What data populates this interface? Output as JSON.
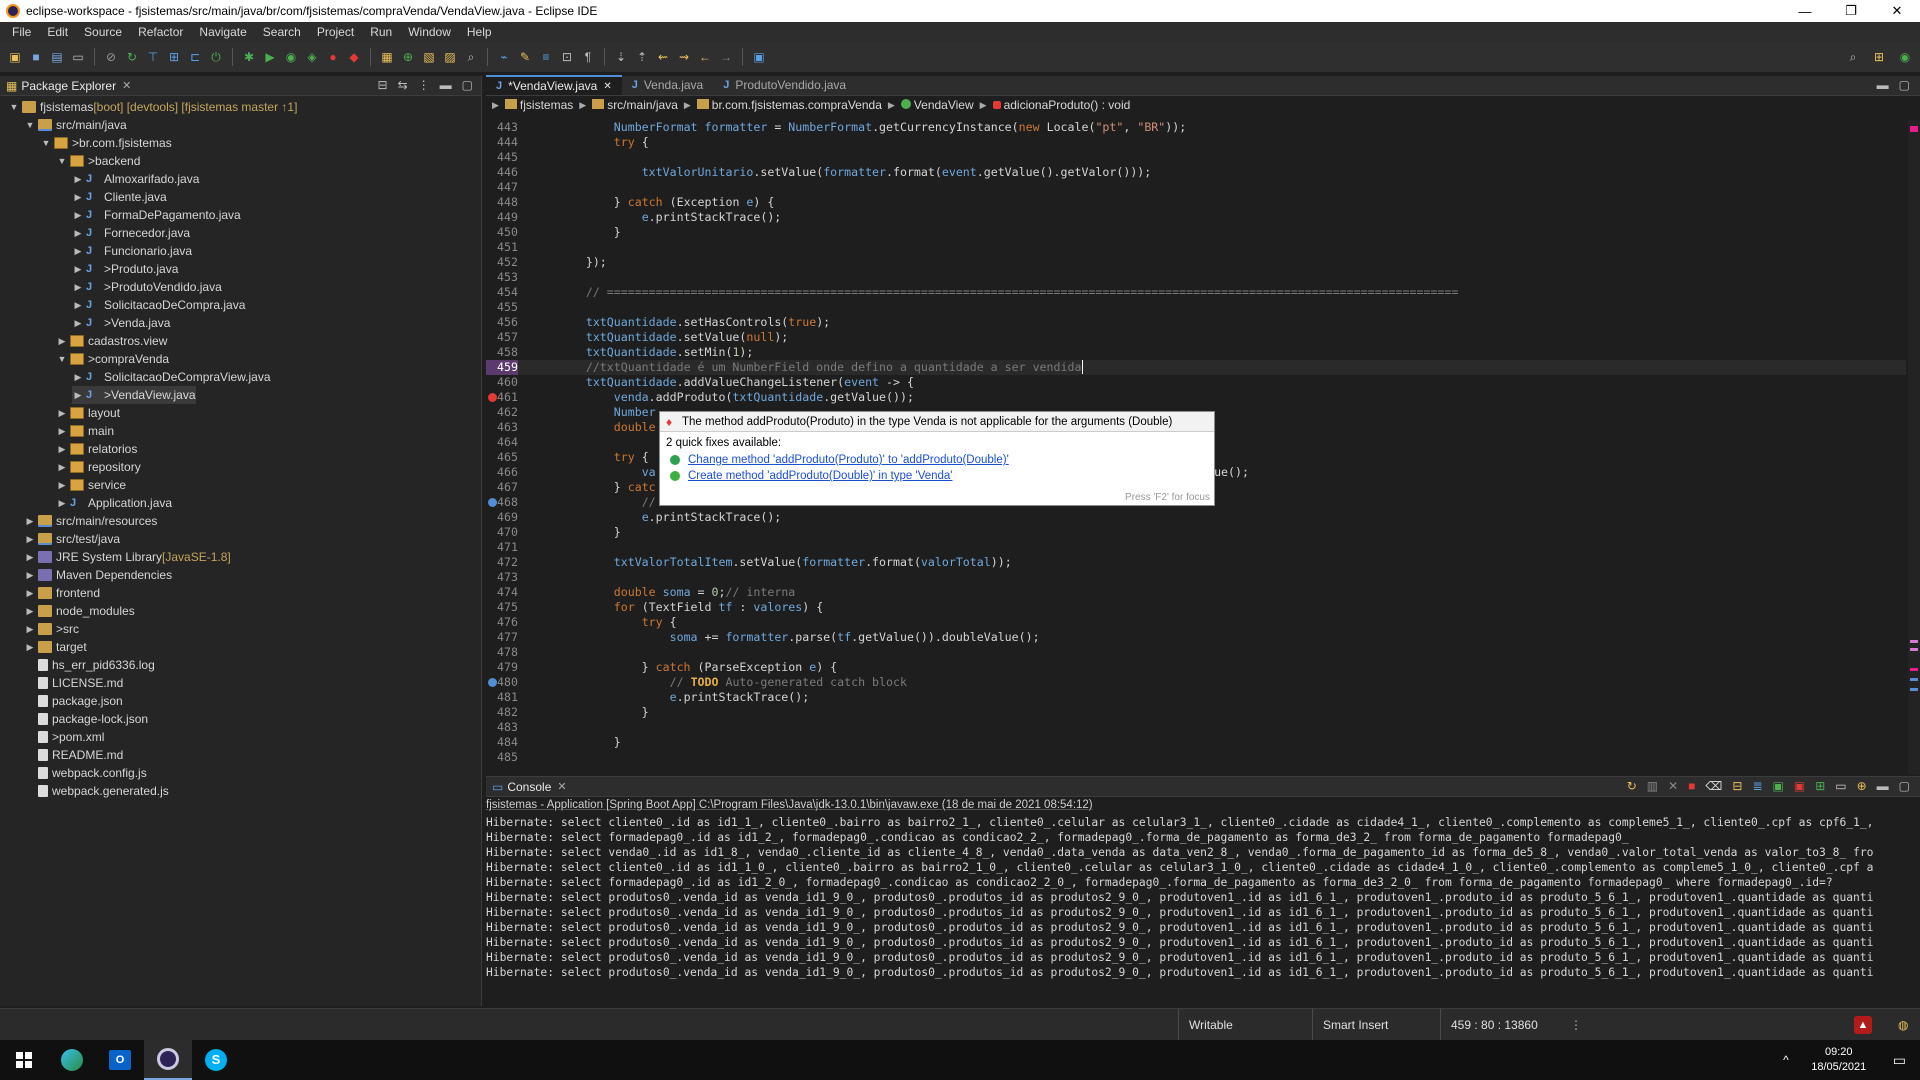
{
  "window": {
    "title": "eclipse-workspace - fjsistemas/src/main/java/br/com/fjsistemas/compraVenda/VendaView.java - Eclipse IDE"
  },
  "menu": [
    "File",
    "Edit",
    "Source",
    "Refactor",
    "Navigate",
    "Search",
    "Project",
    "Run",
    "Window",
    "Help"
  ],
  "package_explorer": {
    "title": "Package Explorer",
    "tree": [
      {
        "label": "fjsistemas",
        "decor": " [boot] [devtools] [fjsistemas master ↑1]",
        "indent": 0,
        "expanded": true,
        "icon": "project"
      },
      {
        "label": "src/main/java",
        "decor": "",
        "indent": 1,
        "expanded": true,
        "icon": "src"
      },
      {
        "label": "br.com.fjsistemas",
        "decor": "",
        "prefix": "> ",
        "indent": 2,
        "expanded": true,
        "icon": "pkg"
      },
      {
        "label": "backend",
        "decor": "",
        "prefix": "> ",
        "indent": 3,
        "expanded": true,
        "icon": "pkg"
      },
      {
        "label": "Almoxarifado.java",
        "decor": "",
        "indent": 4,
        "expanded": false,
        "icon": "java"
      },
      {
        "label": "Cliente.java",
        "decor": "",
        "indent": 4,
        "expanded": false,
        "icon": "java"
      },
      {
        "label": "FormaDePagamento.java",
        "decor": "",
        "indent": 4,
        "expanded": false,
        "icon": "java"
      },
      {
        "label": "Fornecedor.java",
        "decor": "",
        "indent": 4,
        "expanded": false,
        "icon": "java"
      },
      {
        "label": "Funcionario.java",
        "decor": "",
        "indent": 4,
        "expanded": false,
        "icon": "java"
      },
      {
        "label": "Produto.java",
        "decor": "",
        "prefix": "> ",
        "indent": 4,
        "expanded": false,
        "icon": "java"
      },
      {
        "label": "ProdutoVendido.java",
        "decor": "",
        "prefix": "> ",
        "indent": 4,
        "expanded": false,
        "icon": "java"
      },
      {
        "label": "SolicitacaoDeCompra.java",
        "decor": "",
        "indent": 4,
        "expanded": false,
        "icon": "java"
      },
      {
        "label": "Venda.java",
        "decor": "",
        "prefix": "> ",
        "indent": 4,
        "expanded": false,
        "icon": "java"
      },
      {
        "label": "cadastros.view",
        "decor": "",
        "indent": 3,
        "expanded": false,
        "icon": "pkg"
      },
      {
        "label": "compraVenda",
        "decor": "",
        "prefix": "> ",
        "indent": 3,
        "expanded": true,
        "icon": "pkg"
      },
      {
        "label": "SolicitacaoDeCompraView.java",
        "decor": "",
        "indent": 4,
        "expanded": false,
        "icon": "java"
      },
      {
        "label": "VendaView.java",
        "decor": "",
        "prefix": "> ",
        "indent": 4,
        "expanded": false,
        "icon": "java",
        "selected": true
      },
      {
        "label": "layout",
        "decor": "",
        "indent": 3,
        "expanded": false,
        "icon": "pkg"
      },
      {
        "label": "main",
        "decor": "",
        "indent": 3,
        "expanded": false,
        "icon": "pkg"
      },
      {
        "label": "relatorios",
        "decor": "",
        "indent": 3,
        "expanded": false,
        "icon": "pkg"
      },
      {
        "label": "repository",
        "decor": "",
        "indent": 3,
        "expanded": false,
        "icon": "pkg"
      },
      {
        "label": "service",
        "decor": "",
        "indent": 3,
        "expanded": false,
        "icon": "pkg"
      },
      {
        "label": "Application.java",
        "decor": "",
        "indent": 3,
        "expanded": false,
        "icon": "java"
      },
      {
        "label": "src/main/resources",
        "decor": "",
        "indent": 1,
        "expanded": false,
        "icon": "src"
      },
      {
        "label": "src/test/java",
        "decor": "",
        "indent": 1,
        "expanded": false,
        "icon": "src"
      },
      {
        "label": "JRE System Library",
        "decor": " [JavaSE-1.8]",
        "indent": 1,
        "expanded": false,
        "icon": "lib"
      },
      {
        "label": "Maven Dependencies",
        "decor": "",
        "indent": 1,
        "expanded": false,
        "icon": "lib"
      },
      {
        "label": "frontend",
        "decor": "",
        "indent": 1,
        "expanded": false,
        "icon": "folder"
      },
      {
        "label": "node_modules",
        "decor": "",
        "indent": 1,
        "expanded": false,
        "icon": "folder"
      },
      {
        "label": "src",
        "decor": "",
        "prefix": "> ",
        "indent": 1,
        "expanded": false,
        "icon": "folder"
      },
      {
        "label": "target",
        "decor": "",
        "indent": 1,
        "expanded": false,
        "icon": "folder"
      },
      {
        "label": "hs_err_pid6336.log",
        "decor": "",
        "indent": 1,
        "leaf": true,
        "icon": "file"
      },
      {
        "label": "LICENSE.md",
        "decor": "",
        "indent": 1,
        "leaf": true,
        "icon": "file"
      },
      {
        "label": "package.json",
        "decor": "",
        "indent": 1,
        "leaf": true,
        "icon": "file"
      },
      {
        "label": "package-lock.json",
        "decor": "",
        "indent": 1,
        "leaf": true,
        "icon": "file"
      },
      {
        "label": "pom.xml",
        "decor": "",
        "prefix": "> ",
        "indent": 1,
        "leaf": true,
        "icon": "file"
      },
      {
        "label": "README.md",
        "decor": "",
        "indent": 1,
        "leaf": true,
        "icon": "file"
      },
      {
        "label": "webpack.config.js",
        "decor": "",
        "indent": 1,
        "leaf": true,
        "icon": "file"
      },
      {
        "label": "webpack.generated.js",
        "decor": "",
        "indent": 1,
        "leaf": true,
        "icon": "file"
      }
    ]
  },
  "editor": {
    "tabs": [
      {
        "label": "*VendaView.java",
        "active": true
      },
      {
        "label": "Venda.java",
        "active": false
      },
      {
        "label": "ProdutoVendido.java",
        "active": false
      }
    ],
    "breadcrumb": [
      "fjsistemas",
      "src/main/java",
      "br.com.fjsistemas.compraVenda",
      "VendaView",
      "adicionaProduto() : void"
    ],
    "current_line": "459",
    "lines": [
      {
        "n": "443",
        "html": "            <span class=\"f\">NumberFormat</span> <span class=\"f\">formatter</span> = <span class=\"f\">NumberFormat</span>.getCurrencyInstance(<span class=\"k\">new</span> Locale(<span class=\"s\">\"pt\"</span>, <span class=\"s\">\"BR\"</span>));"
      },
      {
        "n": "444",
        "html": "            <span class=\"k\">try</span> {"
      },
      {
        "n": "445",
        "html": ""
      },
      {
        "n": "446",
        "html": "                <span class=\"f\">txtValorUnitario</span>.setValue(<span class=\"f\">formatter</span>.format(<span class=\"f\">event</span>.getValue().getValor()));"
      },
      {
        "n": "447",
        "html": ""
      },
      {
        "n": "448",
        "html": "            } <span class=\"k\">catch</span> (Exception <span class=\"f\">e</span>) {"
      },
      {
        "n": "449",
        "html": "                <span class=\"f\">e</span>.printStackTrace();"
      },
      {
        "n": "450",
        "html": "            }"
      },
      {
        "n": "451",
        "html": ""
      },
      {
        "n": "452",
        "html": "        });"
      },
      {
        "n": "453",
        "html": ""
      },
      {
        "n": "454",
        "html": "        <span class=\"c\">// ==========================================================================================================================</span>"
      },
      {
        "n": "455",
        "html": ""
      },
      {
        "n": "456",
        "html": "        <span class=\"f\">txtQuantidade</span>.setHasControls(<span class=\"k\">true</span>);"
      },
      {
        "n": "457",
        "html": "        <span class=\"f\">txtQuantidade</span>.setValue(<span class=\"k\">null</span>);"
      },
      {
        "n": "458",
        "html": "        <span class=\"f\">txtQuantidade</span>.setMin(<span class=\"n\">1</span>);"
      },
      {
        "n": "459",
        "html": "        <span class=\"c\">//txtQuantidade é um NumberField onde defino a quantidade a ser vendida</span>",
        "current": true
      },
      {
        "n": "460",
        "html": "        <span class=\"f\">txtQuantidade</span>.addValueChangeListener(<span class=\"f\">event</span> -> {"
      },
      {
        "n": "461",
        "html": "            <span class=\"f\">venda</span>.addProduto(<span class=\"f\">txtQuantidade</span>.getValue());",
        "marker": "error"
      },
      {
        "n": "462",
        "html": "            <span class=\"f\">Number</span>"
      },
      {
        "n": "463",
        "html": "            <span class=\"k\">double</span>"
      },
      {
        "n": "464",
        "html": ""
      },
      {
        "n": "465",
        "html": "            <span class=\"k\">try</span> {"
      },
      {
        "n": "466",
        "html": "                <span class=\"f\">va</span>                                                                    <span class=\"f\">idade</span>.getValue();"
      },
      {
        "n": "467",
        "html": "            } <span class=\"k\">catc</span>"
      },
      {
        "n": "468",
        "html": "                <span class=\"c\">//</span>",
        "marker": "info"
      },
      {
        "n": "469",
        "html": "                <span class=\"f\">e</span>.printStackTrace();"
      },
      {
        "n": "470",
        "html": "            }"
      },
      {
        "n": "471",
        "html": ""
      },
      {
        "n": "472",
        "html": "            <span class=\"f\">txtValorTotalItem</span>.setValue(<span class=\"f\">formatter</span>.format(<span class=\"f\">valorTotal</span>));"
      },
      {
        "n": "473",
        "html": ""
      },
      {
        "n": "474",
        "html": "            <span class=\"k\">double</span> <span class=\"f\">soma</span> = <span class=\"n\">0</span>;<span class=\"c\">// interna</span>"
      },
      {
        "n": "475",
        "html": "            <span class=\"k\">for</span> (TextField <span class=\"f\">tf</span> : <span class=\"f\">valores</span>) {"
      },
      {
        "n": "476",
        "html": "                <span class=\"k\">try</span> {"
      },
      {
        "n": "477",
        "html": "                    <span class=\"f\">soma</span> += <span class=\"f\">formatter</span>.parse(<span class=\"f\">tf</span>.getValue()).doubleValue();"
      },
      {
        "n": "478",
        "html": ""
      },
      {
        "n": "479",
        "html": "                } <span class=\"k\">catch</span> (ParseException <span class=\"f\">e</span>) {"
      },
      {
        "n": "480",
        "html": "                    <span class=\"c\">// </span><span class=\"todo\">TODO</span><span class=\"c\"> Auto-generated catch block</span>",
        "marker": "info"
      },
      {
        "n": "481",
        "html": "                    <span class=\"f\">e</span>.printStackTrace();"
      },
      {
        "n": "482",
        "html": "                }"
      },
      {
        "n": "483",
        "html": ""
      },
      {
        "n": "484",
        "html": "            }"
      },
      {
        "n": "485",
        "html": ""
      }
    ]
  },
  "quickfix": {
    "message": "The method addProduto(Produto) in the type Venda is not applicable for the arguments (Double)",
    "count_label": "2 quick fixes available:",
    "fixes": [
      {
        "label": "Change method 'addProduto(Produto)' to 'addProduto(Double)'",
        "color": "#2e9e4f"
      },
      {
        "label": "Create method 'addProduto(Double)' in type 'Venda'",
        "color": "#3cb043"
      }
    ],
    "footer": "Press 'F2' for focus"
  },
  "console": {
    "title": "Console",
    "info": "fjsistemas - Application [Spring Boot App] C:\\Program Files\\Java\\jdk-13.0.1\\bin\\javaw.exe  (18 de mai de 2021 08:54:12)",
    "lines": [
      "Hibernate: select cliente0_.id as id1_1_, cliente0_.bairro as bairro2_1_, cliente0_.celular as celular3_1_, cliente0_.cidade as cidade4_1_, cliente0_.complemento as compleme5_1_, cliente0_.cpf as cpf6_1_,",
      "Hibernate: select formadepag0_.id as id1_2_, formadepag0_.condicao as condicao2_2_, formadepag0_.forma_de_pagamento as forma_de3_2_ from forma_de_pagamento formadepag0_",
      "Hibernate: select venda0_.id as id1_8_, venda0_.cliente_id as cliente_4_8_, venda0_.data_venda as data_ven2_8_, venda0_.forma_de_pagamento_id as forma_de5_8_, venda0_.valor_total_venda as valor_to3_8_ fro",
      "Hibernate: select cliente0_.id as id1_1_0_, cliente0_.bairro as bairro2_1_0_, cliente0_.celular as celular3_1_0_, cliente0_.cidade as cidade4_1_0_, cliente0_.complemento as compleme5_1_0_, cliente0_.cpf a",
      "Hibernate: select formadepag0_.id as id1_2_0_, formadepag0_.condicao as condicao2_2_0_, formadepag0_.forma_de_pagamento as forma_de3_2_0_ from forma_de_pagamento formadepag0_ where formadepag0_.id=?",
      "Hibernate: select produtos0_.venda_id as venda_id1_9_0_, produtos0_.produtos_id as produtos2_9_0_, produtoven1_.id as id1_6_1_, produtoven1_.produto_id as produto_5_6_1_, produtoven1_.quantidade as quanti",
      "Hibernate: select produtos0_.venda_id as venda_id1_9_0_, produtos0_.produtos_id as produtos2_9_0_, produtoven1_.id as id1_6_1_, produtoven1_.produto_id as produto_5_6_1_, produtoven1_.quantidade as quanti",
      "Hibernate: select produtos0_.venda_id as venda_id1_9_0_, produtos0_.produtos_id as produtos2_9_0_, produtoven1_.id as id1_6_1_, produtoven1_.produto_id as produto_5_6_1_, produtoven1_.quantidade as quanti",
      "Hibernate: select produtos0_.venda_id as venda_id1_9_0_, produtos0_.produtos_id as produtos2_9_0_, produtoven1_.id as id1_6_1_, produtoven1_.produto_id as produto_5_6_1_, produtoven1_.quantidade as quanti",
      "Hibernate: select produtos0_.venda_id as venda_id1_9_0_, produtos0_.produtos_id as produtos2_9_0_, produtoven1_.id as id1_6_1_, produtoven1_.produto_id as produto_5_6_1_, produtoven1_.quantidade as quanti",
      "Hibernate: select produtos0_.venda_id as venda_id1_9_0_, produtos0_.produtos_id as produtos2_9_0_, produtoven1_.id as id1_6_1_, produtoven1_.produto_id as produto_5_6_1_, produtoven1_.quantidade as quanti"
    ]
  },
  "status": {
    "writable": "Writable",
    "insert_mode": "Smart Insert",
    "position": "459 : 80 : 13860"
  },
  "taskbar": {
    "time": "09:20",
    "date": "18/05/2021"
  },
  "colors": {
    "accent": "#4f8fd6",
    "error": "#e53935"
  }
}
